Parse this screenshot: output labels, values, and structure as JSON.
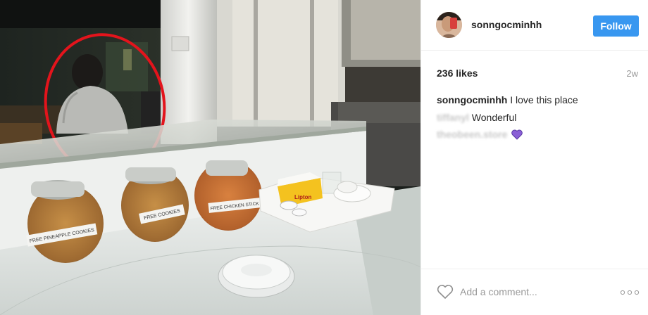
{
  "post": {
    "photo": {
      "jar_labels": [
        "FREE PINEAPPLE COOKIES",
        "FREE COOKIES",
        "FREE CHICKEN STICK"
      ],
      "tea_box_brand": "Lipton"
    },
    "header": {
      "username": "sonngocminhh",
      "follow_label": "Follow",
      "accent_color": "#3897f0"
    },
    "likes": "236 likes",
    "age": "2w",
    "comments": [
      {
        "author": "sonngocminhh",
        "text": "I love this place",
        "author_blurred": false
      },
      {
        "author": "tiffanyl",
        "text": "Wonderful",
        "author_blurred": true
      },
      {
        "author": "theobeen.store",
        "text": "",
        "emoji": "purple-heart",
        "author_blurred": true
      }
    ],
    "footer": {
      "like_icon": "heart-outline-icon",
      "comment_placeholder": "Add a comment...",
      "more_icon": "ellipsis-icon"
    }
  }
}
